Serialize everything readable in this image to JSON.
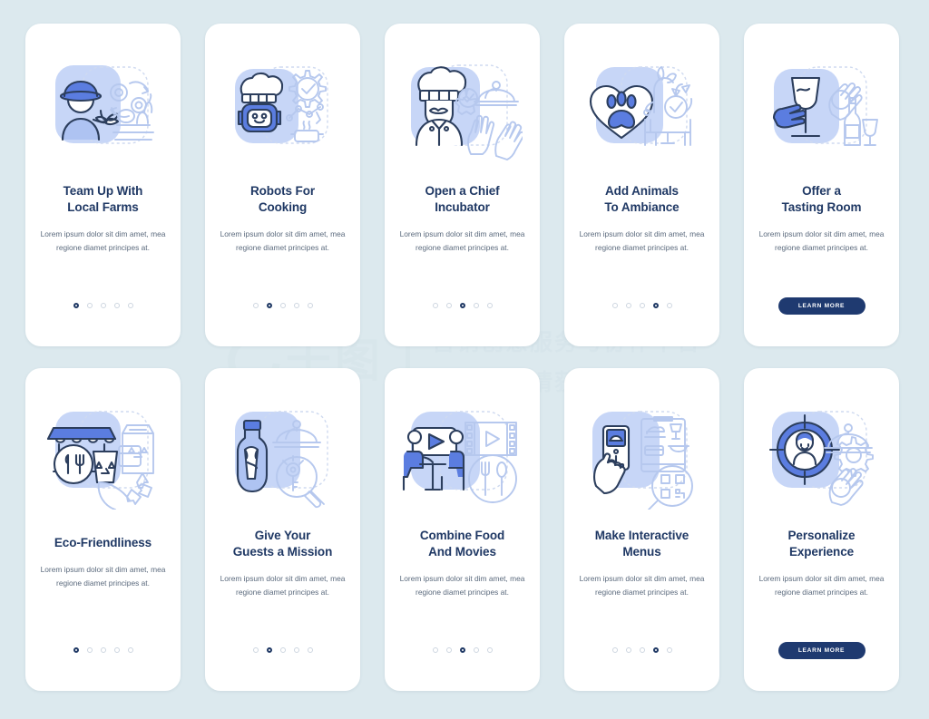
{
  "page": {
    "background_color": "#dce9ee",
    "card_background": "#ffffff",
    "title_color": "#1f3864",
    "body_color": "#5b6a7d",
    "accent_color": "#1f3a70",
    "illustration_blue": "#5b7de0",
    "illustration_light": "#c7d6f7"
  },
  "watermark": {
    "brand_cn": "千图",
    "tagline": "营销创意服务与协作平台",
    "notice": "商用请获取授权"
  },
  "body_text": "Lorem ipsum dolor sit dim amet, mea regione diamet principes at.",
  "cta_label": "LEARN MORE",
  "dots_total": 5,
  "rows": [
    {
      "name": "top-row",
      "cards": [
        {
          "title": "Team Up With\nLocal Farms",
          "title_line1": "Team Up With",
          "title_line2": "Local Farms",
          "illustration": "farmer-with-plant-and-vegetables-icon",
          "body": "Lorem ipsum dolor sit dim amet, mea regione diamet principes at.",
          "active_dot": 1,
          "has_cta": false
        },
        {
          "title": "Robots For\nCooking",
          "title_line1": "Robots For",
          "title_line2": "Cooking",
          "illustration": "chef-robot-with-gear-icon",
          "body": "Lorem ipsum dolor sit dim amet, mea regione diamet principes at.",
          "active_dot": 2,
          "has_cta": false
        },
        {
          "title": "Open a Chief\nIncubator",
          "title_line1": "Open a Chief",
          "title_line2": "Incubator",
          "illustration": "chef-with-cloche-and-gloves-icon",
          "body": "Lorem ipsum dolor sit dim amet, mea regione diamet principes at.",
          "active_dot": 3,
          "has_cta": false
        },
        {
          "title": "Add Animals\nTo Ambiance",
          "title_line1": "Add Animals",
          "title_line2": "To Ambiance",
          "illustration": "paw-in-heart-with-pets-icon",
          "body": "Lorem ipsum dolor sit dim amet, mea regione diamet principes at.",
          "active_dot": 4,
          "has_cta": false
        },
        {
          "title": "Offer a\nTasting Room",
          "title_line1": "Offer a",
          "title_line2": "Tasting Room",
          "illustration": "hand-holding-wine-glass-icon",
          "body": "Lorem ipsum dolor sit dim amet, mea regione diamet principes at.",
          "active_dot": 5,
          "has_cta": true
        }
      ]
    },
    {
      "name": "bottom-row",
      "cards": [
        {
          "title": "Eco-Friendliness",
          "title_line1": "Eco-Friendliness",
          "title_line2": "",
          "illustration": "market-stall-with-recycling-icon",
          "body": "Lorem ipsum dolor sit dim amet, mea regione diamet principes at.",
          "active_dot": 1,
          "has_cta": false
        },
        {
          "title": "Give Your\nGuests a Mission",
          "title_line1": "Give Your",
          "title_line2": "Guests a Mission",
          "illustration": "message-in-bottle-with-key-icon",
          "body": "Lorem ipsum dolor sit dim amet, mea regione diamet principes at.",
          "active_dot": 2,
          "has_cta": false
        },
        {
          "title": "Combine Food\nAnd Movies",
          "title_line1": "Combine Food",
          "title_line2": "And Movies",
          "illustration": "diners-watching-movie-icon",
          "body": "Lorem ipsum dolor sit dim amet, mea regione diamet principes at.",
          "active_dot": 3,
          "has_cta": false
        },
        {
          "title": "Make Interactive\nMenus",
          "title_line1": "Make Interactive",
          "title_line2": "Menus",
          "illustration": "phone-menu-with-qr-code-icon",
          "body": "Lorem ipsum dolor sit dim amet, mea regione diamet principes at.",
          "active_dot": 4,
          "has_cta": false
        },
        {
          "title": "Personalize\nExperience",
          "title_line1": "Personalize",
          "title_line2": "Experience",
          "illustration": "targeted-person-with-cloche-icon",
          "body": "Lorem ipsum dolor sit dim amet, mea regione diamet principes at.",
          "active_dot": 5,
          "has_cta": true
        }
      ]
    }
  ]
}
